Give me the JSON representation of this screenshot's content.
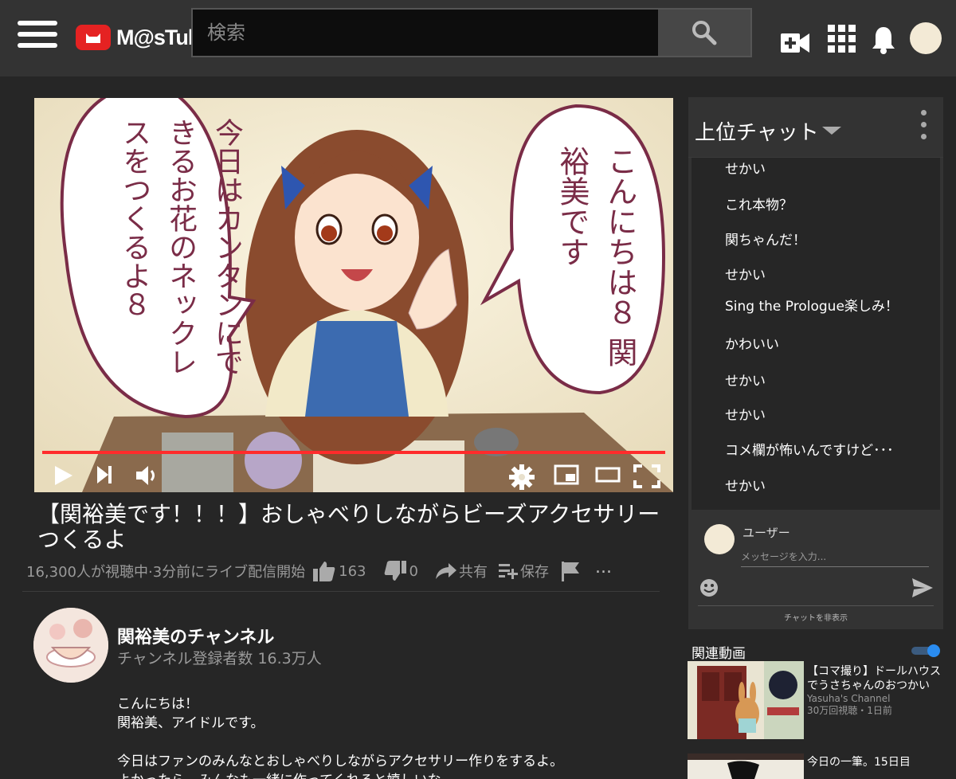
{
  "header": {
    "logo_text": "M@sTube",
    "search_placeholder": "検索"
  },
  "video": {
    "title": "【関裕美です！！！】おしゃべりしながらビーズアクセサリーつくるよ",
    "speech_left": "今日はカンタンにできるお花のネックレスをつくるよ８",
    "speech_right": "こんにちは８ 関裕美です",
    "progress": 1.0
  },
  "meta": {
    "views": "16,300人が視聴中·3分前にライブ配信開始",
    "likes": "163",
    "dislikes": "0",
    "share": "共有",
    "save": "保存",
    "more": "..."
  },
  "channel": {
    "name": "関裕美のチャンネル",
    "subscribers": "チャンネル登録者数 16.3万人"
  },
  "description": {
    "line1": "こんにちは！",
    "line2": "関裕美、アイドルです。",
    "line3": "今日はファンのみんなとおしゃべりしながらアクセサリー作りをするよ。",
    "line4": "よかったら、みんなも一緒に作ってくれると嬉しいな"
  },
  "chat": {
    "title": "上位チャット",
    "messages": [
      "せかい",
      "これ本物？",
      "関ちゃんだ！",
      "せかい",
      "Sing the Prologue楽しみ！",
      "かわいい",
      "せかい",
      "せかい",
      "コメ欄が怖いんですけど･･･",
      "せかい"
    ],
    "user_name": "ユーザー",
    "input_placeholder": "メッセージを入力...",
    "hide_label": "チャットを非表示"
  },
  "related": {
    "title": "関連動画",
    "autoplay_on": true,
    "items": [
      {
        "title": "【コマ撮り】ドールハウスでうさちゃんのおつかい",
        "channel": "Yasuha's Channel",
        "stats": "30万回視聴・1日前"
      },
      {
        "title": "今日の一筆。15日目",
        "channel": "",
        "stats": ""
      }
    ]
  },
  "colors": {
    "accent_red": "#ff2b2b",
    "bg": "#262626",
    "header_bg": "#333333",
    "toggle_blue": "#2a8cf0"
  }
}
